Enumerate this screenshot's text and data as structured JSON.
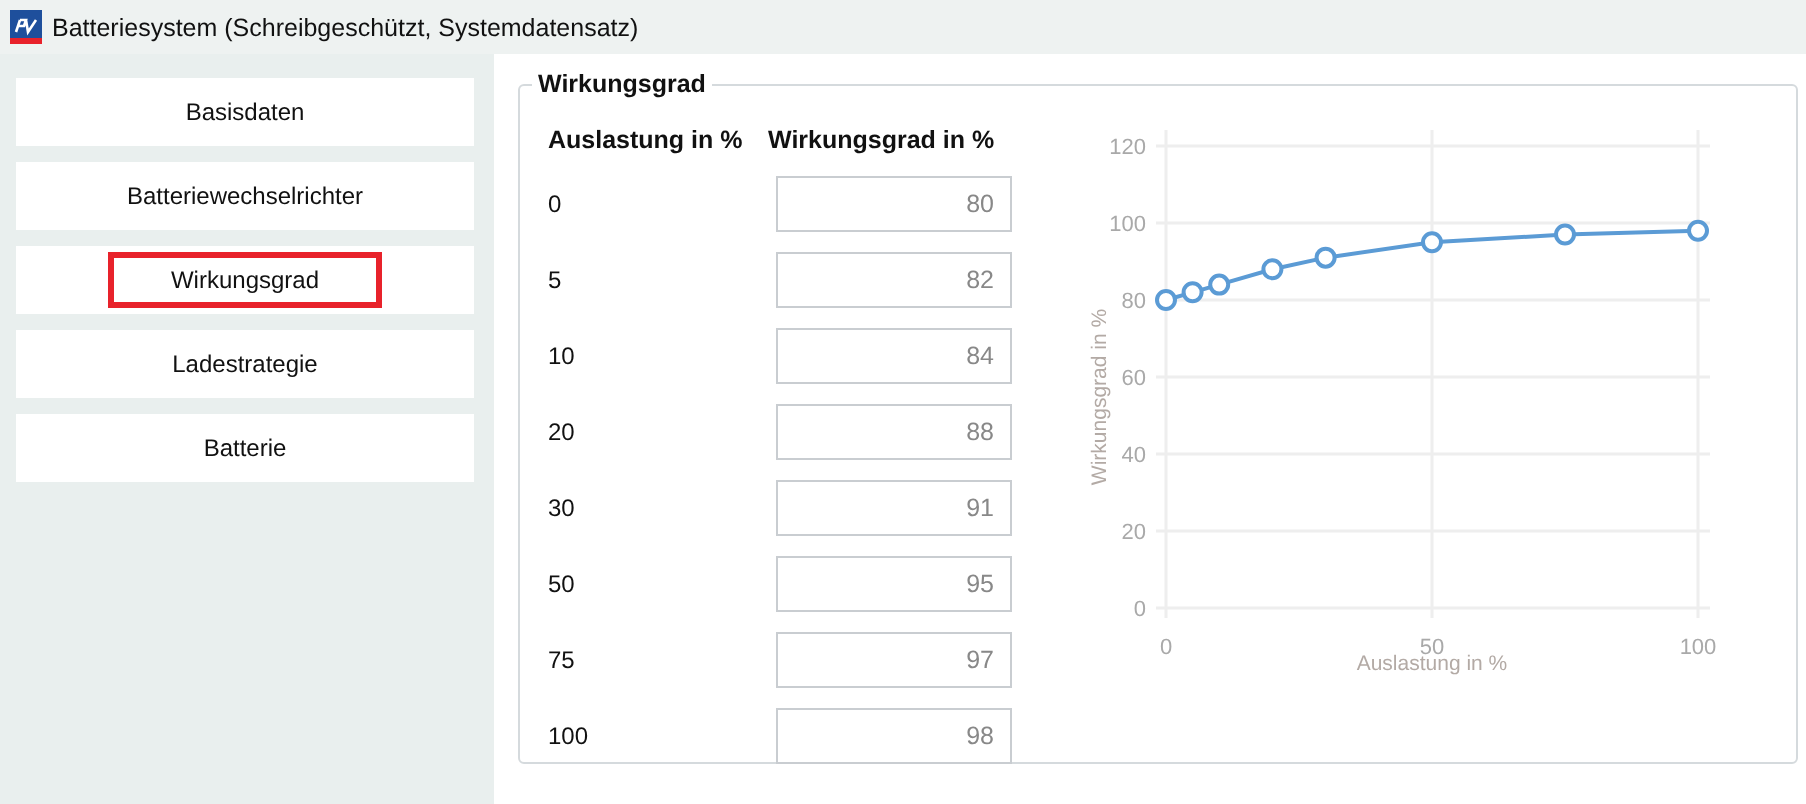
{
  "window": {
    "title": "Batteriesystem (Schreibgeschützt, Systemdatensatz)"
  },
  "sidebar": {
    "items": [
      {
        "label": "Basisdaten",
        "selected": false
      },
      {
        "label": "Batteriewechselrichter",
        "selected": false
      },
      {
        "label": "Wirkungsgrad",
        "selected": true
      },
      {
        "label": "Ladestrategie",
        "selected": false
      },
      {
        "label": "Batterie",
        "selected": false
      }
    ]
  },
  "panel": {
    "title": "Wirkungsgrad",
    "columns": [
      "Auslastung in %",
      "Wirkungsgrad in %"
    ],
    "rows": [
      {
        "load": "0",
        "value": "80"
      },
      {
        "load": "5",
        "value": "82"
      },
      {
        "load": "10",
        "value": "84"
      },
      {
        "load": "20",
        "value": "88"
      },
      {
        "load": "30",
        "value": "91"
      },
      {
        "load": "50",
        "value": "95"
      },
      {
        "load": "75",
        "value": "97"
      },
      {
        "load": "100",
        "value": "98"
      }
    ],
    "chart_data": {
      "type": "line",
      "xlabel": "Auslastung in %",
      "ylabel": "Wirkungsgrad in %",
      "x": [
        0,
        5,
        10,
        20,
        30,
        50,
        75,
        100
      ],
      "series": [
        {
          "color": "#5b9bd5",
          "marker": "circle",
          "values": [
            80,
            82,
            84,
            88,
            91,
            95,
            97,
            98
          ]
        }
      ],
      "grid": true,
      "xlim": [
        0,
        100
      ],
      "ylim": [
        0,
        120
      ],
      "xticks": [
        0,
        50,
        100
      ],
      "yticks": [
        0,
        20,
        40,
        60,
        80,
        100,
        120
      ]
    }
  }
}
